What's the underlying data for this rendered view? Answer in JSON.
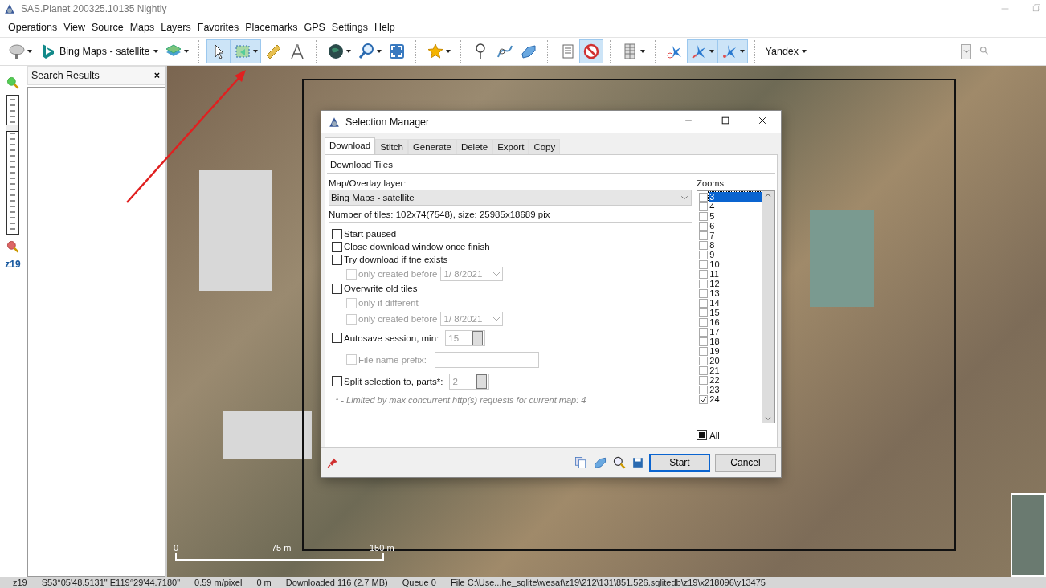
{
  "window": {
    "title": "SAS.Planet 200325.10135 Nightly"
  },
  "menu": [
    "Operations",
    "View",
    "Source",
    "Maps",
    "Layers",
    "Favorites",
    "Placemarks",
    "GPS",
    "Settings",
    "Help"
  ],
  "toolbar": {
    "map_source": "Bing Maps - satellite",
    "search_provider": "Yandex",
    "tools": [
      {
        "on": false
      },
      {
        "on": false
      },
      {
        "on": true
      },
      {
        "on": true
      },
      {
        "on": false
      },
      {
        "on": false
      },
      {
        "on": false
      },
      {
        "on": false
      },
      {
        "on": false
      },
      {
        "on": false
      },
      {
        "on": false
      },
      {
        "on": false
      },
      {
        "on": false
      },
      {
        "on": false
      },
      {
        "on": true
      },
      {
        "on": false
      },
      {
        "on": false
      },
      {
        "on": true
      },
      {
        "on": true
      }
    ]
  },
  "zoom_bar": {
    "level": 0.78,
    "label": "z19"
  },
  "search_panel": {
    "title": "Search Results",
    "close": "×"
  },
  "map": {
    "scale": [
      "0",
      "75 m",
      "150 m"
    ]
  },
  "dialog": {
    "title": "Selection Manager",
    "tabs": [
      {
        "label": "Download",
        "selected": true
      },
      {
        "label": "Stitch",
        "selected": false
      },
      {
        "label": "Generate",
        "selected": false
      },
      {
        "label": "Delete",
        "selected": false
      },
      {
        "label": "Export",
        "selected": false
      },
      {
        "label": "Copy",
        "selected": false
      }
    ],
    "heading": "Download Tiles",
    "layer_label": "Map/Overlay layer:",
    "layer": "Bing Maps - satellite",
    "tiles_info": "Number of tiles: 102x74(7548), size: 25985x18689 pix",
    "options": [
      {
        "label": "Start paused",
        "checked": false,
        "disabled": false,
        "kind": "plain"
      },
      {
        "label": "Close download window once finish",
        "checked": false,
        "disabled": false,
        "kind": "plain"
      },
      {
        "label": "Try download if tne exists",
        "checked": false,
        "disabled": false,
        "kind": "plain",
        "children": [
          {
            "label": "only created before",
            "checked": false,
            "disabled": true,
            "kind": "date",
            "value": "1/  8/2021"
          }
        ]
      },
      {
        "label": "Overwrite old tiles",
        "checked": false,
        "disabled": false,
        "kind": "plain",
        "children": [
          {
            "label": "only if different",
            "checked": false,
            "disabled": true,
            "kind": "plain"
          },
          {
            "label": "only created before",
            "checked": false,
            "disabled": true,
            "kind": "date",
            "value": "1/  8/2021"
          }
        ]
      },
      {
        "label": "Autosave session, min:",
        "checked": false,
        "disabled": false,
        "kind": "spin",
        "value": "15",
        "children": [
          {
            "label": "File name prefix:",
            "checked": false,
            "disabled": true,
            "kind": "text"
          }
        ]
      },
      {
        "label": "Split selection to, parts*:",
        "checked": false,
        "disabled": false,
        "kind": "spin",
        "value": "2"
      }
    ],
    "footnote": "* - Limited by max concurrent http(s) requests for current map: 4",
    "zooms_label": "Zooms:",
    "zooms": [
      {
        "label": "3",
        "checked": false,
        "selected": true
      },
      {
        "label": "4",
        "checked": false,
        "selected": false
      },
      {
        "label": "5",
        "checked": false,
        "selected": false
      },
      {
        "label": "6",
        "checked": false,
        "selected": false
      },
      {
        "label": "7",
        "checked": false,
        "selected": false
      },
      {
        "label": "8",
        "checked": false,
        "selected": false
      },
      {
        "label": "9",
        "checked": false,
        "selected": false
      },
      {
        "label": "10",
        "checked": false,
        "selected": false
      },
      {
        "label": "11",
        "checked": false,
        "selected": false
      },
      {
        "label": "12",
        "checked": false,
        "selected": false
      },
      {
        "label": "13",
        "checked": false,
        "selected": false
      },
      {
        "label": "14",
        "checked": false,
        "selected": false
      },
      {
        "label": "15",
        "checked": false,
        "selected": false
      },
      {
        "label": "16",
        "checked": false,
        "selected": false
      },
      {
        "label": "17",
        "checked": false,
        "selected": false
      },
      {
        "label": "18",
        "checked": false,
        "selected": false
      },
      {
        "label": "19",
        "checked": false,
        "selected": false
      },
      {
        "label": "20",
        "checked": false,
        "selected": false
      },
      {
        "label": "21",
        "checked": false,
        "selected": false
      },
      {
        "label": "22",
        "checked": false,
        "selected": false
      },
      {
        "label": "23",
        "checked": false,
        "selected": false
      },
      {
        "label": "24",
        "checked": true,
        "selected": false
      }
    ],
    "all": {
      "label": "All",
      "checked": true
    },
    "buttons": [
      "Start",
      "Cancel"
    ]
  },
  "status_bar": [
    "z19",
    "S53°05'48.5131\" E119°29'44.7180\"",
    "0.59 m/pixel",
    "0 m",
    "Downloaded 116 (2.7 MB)",
    "Queue 0",
    "File C:\\Use...he_sqlite\\wesat\\z19\\212\\131\\851.526.sqlitedb\\z19\\x218096\\y13475"
  ]
}
